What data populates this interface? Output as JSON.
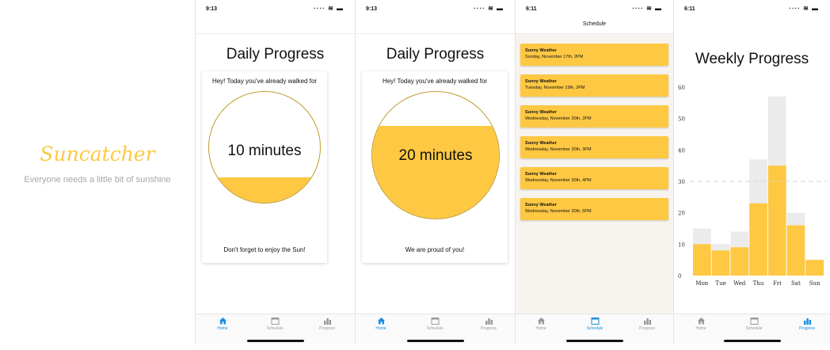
{
  "splash": {
    "title": "Suncatcher",
    "subtitle": "Everyone needs a little bit of sunshine"
  },
  "status": {
    "time_a": "9:13",
    "time_b": "6:11",
    "signal": "····",
    "wifi": "≋",
    "battery": "▬"
  },
  "tabs": {
    "home": "Home",
    "schedule": "Schedule",
    "progress": "Progress"
  },
  "home1": {
    "title": "Daily Progress",
    "greeting": "Hey! Today you've already walked for",
    "minutes": "10 minutes",
    "message": "Don't forget to enjoy the Sun!",
    "fill_fraction": 0.23
  },
  "home2": {
    "title": "Daily Progress",
    "greeting": "Hey! Today you've already walked for",
    "minutes": "20 minutes",
    "message": "We are proud of you!",
    "fill_fraction": 0.73
  },
  "schedule": {
    "header": "Schedule",
    "events": [
      {
        "title": "Sunny Weather",
        "date": "Sunday, November 17th, 2PM"
      },
      {
        "title": "Sunny Weather",
        "date": "Tuesday, November 19th, 2PM"
      },
      {
        "title": "Sunny Weather",
        "date": "Wednesday, November 20th, 2PM"
      },
      {
        "title": "Sunny Weather",
        "date": "Wednesday, November 20th, 3PM"
      },
      {
        "title": "Sunny Weather",
        "date": "Wednesday, November 20th, 4PM"
      },
      {
        "title": "Sunny Weather",
        "date": "Wednesday, November 20th, 5PM"
      }
    ]
  },
  "weekly": {
    "title": "Weekly Progress"
  },
  "colors": {
    "accent": "#fec842",
    "active_tab": "#1a8fe3",
    "ghost_bar": "#ebebeb"
  },
  "chart_data": {
    "type": "bar",
    "categories": [
      "Mon",
      "Tue",
      "Wed",
      "Thu",
      "Fri",
      "Sat",
      "Sun"
    ],
    "series": [
      {
        "values": [
          10,
          8,
          9,
          23,
          35,
          16,
          5
        ]
      },
      {
        "values": [
          15,
          10,
          14,
          37,
          57,
          20,
          5
        ]
      }
    ],
    "y_ticks": [
      "0",
      "10",
      "20",
      "30",
      "40",
      "50",
      "60"
    ],
    "ylim": [
      0,
      60
    ],
    "reference_line": 30,
    "bar_mode": "overlay",
    "grid": false
  }
}
